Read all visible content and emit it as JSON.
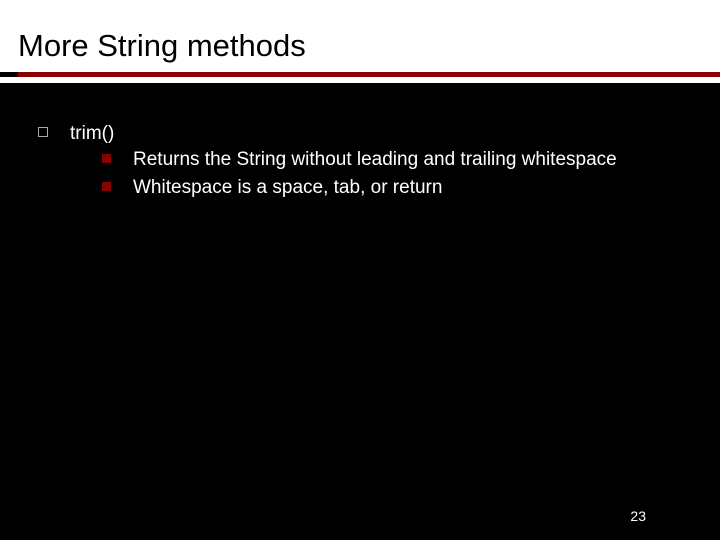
{
  "slide": {
    "title": "More String methods",
    "page_number": "23"
  },
  "content": {
    "item1": {
      "label": "trim()",
      "sub1": "Returns the String without leading and trailing whitespace",
      "sub2": "Whitespace is a space, tab, or return"
    }
  }
}
